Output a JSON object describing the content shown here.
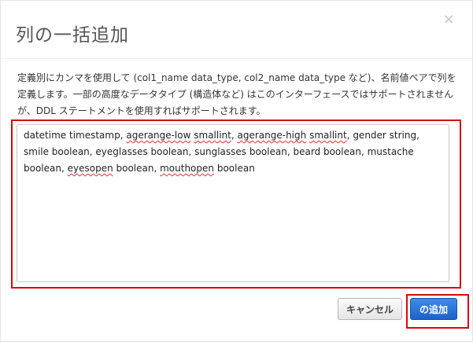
{
  "dialog": {
    "title": "列の一括追加",
    "close_icon_glyph": "×",
    "description": "定義別にカンマを使用して (col1_name data_type, col2_name data_type など)、名前値ペアで列を定義します。一部の高度なデータタイプ (構造体など) はこのインターフェースではサポートされませんが、DDL ステートメントを使用すればサポートされます。",
    "textarea_segments": [
      {
        "text": "datetime timestamp, ",
        "misspelled": false
      },
      {
        "text": "agerange-low",
        "misspelled": true
      },
      {
        "text": " ",
        "misspelled": false
      },
      {
        "text": "smallint",
        "misspelled": true
      },
      {
        "text": ", ",
        "misspelled": false
      },
      {
        "text": "agerange-high",
        "misspelled": true
      },
      {
        "text": " ",
        "misspelled": false
      },
      {
        "text": "smallint",
        "misspelled": true
      },
      {
        "text": ", gender string, smile boolean, eyeglasses boolean, sunglasses boolean, beard boolean, mustache boolean, ",
        "misspelled": false
      },
      {
        "text": "eyesopen",
        "misspelled": true
      },
      {
        "text": " boolean, ",
        "misspelled": false
      },
      {
        "text": "mouthopen",
        "misspelled": true
      },
      {
        "text": " boolean",
        "misspelled": false
      }
    ],
    "cancel_label": "キャンセル",
    "add_label": "の追加"
  },
  "colors": {
    "highlight_border": "#d20a11",
    "primary_button": "#2a6fd6",
    "title_text": "#555555"
  }
}
